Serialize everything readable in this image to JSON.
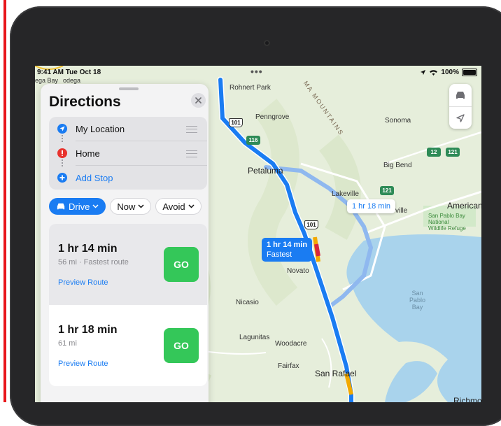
{
  "status_bar": {
    "time": "9:41 AM  Tue Oct 18",
    "battery": "100%",
    "dots": "•••"
  },
  "panel": {
    "title": "Directions",
    "stops": [
      {
        "label": "My Location",
        "icon": "location-arrow-icon",
        "color": "#1a7cf2"
      },
      {
        "label": "Home",
        "icon": "red-pin-icon",
        "color": "#e8322d"
      },
      {
        "label": "Add Stop",
        "icon": "plus-icon",
        "color": "#1a7cf2"
      }
    ],
    "filters": {
      "mode": "Drive",
      "time": "Now",
      "avoid": "Avoid"
    },
    "routes": [
      {
        "time": "1 hr 14 min",
        "detail": "56 mi · Fastest route",
        "preview": "Preview Route",
        "go": "GO"
      },
      {
        "time": "1 hr 18 min",
        "detail": "61 mi",
        "preview": "Preview Route",
        "go": "GO"
      }
    ]
  },
  "map": {
    "callouts": {
      "fastest_time": "1 hr 14 min",
      "fastest_label": "Fastest",
      "alt_time": "1 hr 18 min"
    },
    "places": {
      "rohnert_park": "Rohnert Park",
      "penngrove": "Penngrove",
      "sonoma": "Sonoma",
      "petaluma": "Petaluma",
      "big_bend": "Big Bend",
      "lakeville": "Lakeville",
      "american": "American",
      "ville": "ville",
      "novato": "Novato",
      "nicasio": "Nicasio",
      "lagunitas": "Lagunitas",
      "woodacre": "Woodacre",
      "fairfax": "Fairfax",
      "san_rafael": "San Rafael",
      "richmond": "Richmond",
      "ega_bay": "ega Bay",
      "bodega": "odega",
      "mountains": "MA MOUNTAINS",
      "refuge": "San Pablo Bay\nNational\nWildlife Refuge",
      "bay": "San\nPablo\nBay"
    },
    "shields": {
      "a": "101",
      "b": "116",
      "c": "12",
      "d": "121",
      "e": "121",
      "f": "101"
    },
    "colors": {
      "route": "#1a7cf2",
      "alt_route": "#8fb8ef",
      "water": "#a9d3ec",
      "land": "#e6eedb"
    }
  }
}
